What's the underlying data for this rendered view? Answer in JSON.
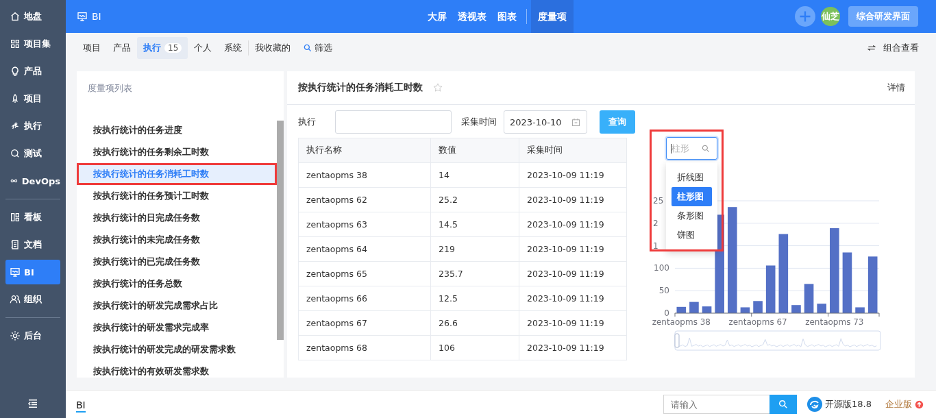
{
  "sidebar": {
    "groups": [
      [
        {
          "label": "地盘",
          "selected": false
        },
        {
          "label": "项目集",
          "selected": false
        },
        {
          "label": "产品",
          "selected": false
        },
        {
          "label": "项目",
          "selected": false
        },
        {
          "label": "执行",
          "selected": false
        },
        {
          "label": "测试",
          "selected": false
        },
        {
          "label": "DevOps",
          "selected": false
        }
      ],
      [
        {
          "label": "看板",
          "selected": false
        },
        {
          "label": "文档",
          "selected": false
        },
        {
          "label": "BI",
          "selected": true
        },
        {
          "label": "组织",
          "selected": false
        }
      ],
      [
        {
          "label": "后台",
          "selected": false
        }
      ]
    ]
  },
  "header": {
    "title": "BI",
    "nav": [
      {
        "label": "大屏",
        "selected": false
      },
      {
        "label": "透视表",
        "selected": false
      },
      {
        "label": "图表",
        "selected": false
      },
      {
        "label": "度量项",
        "selected": true
      }
    ],
    "avatar": "仙芝",
    "switch_button": "综合研发界面"
  },
  "subnav": {
    "tabs": [
      {
        "label": "项目",
        "selected": false
      },
      {
        "label": "产品",
        "selected": false
      },
      {
        "label": "执行",
        "count": "15",
        "selected": true
      },
      {
        "label": "个人",
        "selected": false
      },
      {
        "label": "系统",
        "selected": false
      },
      {
        "label": "我收藏的",
        "selected": false
      }
    ],
    "filter": "筛选",
    "combine": "组合查看"
  },
  "metric_list": {
    "title": "度量项列表",
    "items": [
      {
        "label": "按执行统计的任务进度",
        "selected": false,
        "highlighted": false
      },
      {
        "label": "按执行统计的任务剩余工时数",
        "selected": false,
        "highlighted": false
      },
      {
        "label": "按执行统计的任务消耗工时数",
        "selected": true,
        "highlighted": true
      },
      {
        "label": "按执行统计的任务预计工时数",
        "selected": false,
        "highlighted": false
      },
      {
        "label": "按执行统计的日完成任务数",
        "selected": false,
        "highlighted": false
      },
      {
        "label": "按执行统计的未完成任务数",
        "selected": false,
        "highlighted": false
      },
      {
        "label": "按执行统计的已完成任务数",
        "selected": false,
        "highlighted": false
      },
      {
        "label": "按执行统计的任务总数",
        "selected": false,
        "highlighted": false
      },
      {
        "label": "按执行统计的研发完成需求占比",
        "selected": false,
        "highlighted": false
      },
      {
        "label": "按执行统计的研发需求完成率",
        "selected": false,
        "highlighted": false
      },
      {
        "label": "按执行统计的研发完成的研发需求数",
        "selected": false,
        "highlighted": false
      },
      {
        "label": "按执行统计的有效研发需求数",
        "selected": false,
        "highlighted": false
      }
    ]
  },
  "detail": {
    "title": "按执行统计的任务消耗工时数",
    "details_link": "详情",
    "filters": {
      "execution_label": "执行",
      "time_label": "采集时间",
      "date": "2023-10-10",
      "query_button": "查询"
    },
    "table": {
      "columns": [
        "执行名称",
        "数值",
        "采集时间"
      ],
      "rows": [
        [
          "zentaopms 38",
          "14",
          "2023-10-09 11:19"
        ],
        [
          "zentaopms 62",
          "25.2",
          "2023-10-09 11:19"
        ],
        [
          "zentaopms 63",
          "14.5",
          "2023-10-09 11:19"
        ],
        [
          "zentaopms 64",
          "219",
          "2023-10-09 11:19"
        ],
        [
          "zentaopms 65",
          "235.7",
          "2023-10-09 11:19"
        ],
        [
          "zentaopms 66",
          "12.5",
          "2023-10-09 11:19"
        ],
        [
          "zentaopms 67",
          "26.6",
          "2023-10-09 11:19"
        ],
        [
          "zentaopms 68",
          "106",
          "2023-10-09 11:19"
        ]
      ]
    },
    "chart_type_picker": {
      "search_value": "柱形",
      "highlighted": true,
      "options": [
        {
          "label": "折线图",
          "selected": false
        },
        {
          "label": "柱形图",
          "selected": true
        },
        {
          "label": "条形图",
          "selected": false
        },
        {
          "label": "饼图",
          "selected": false
        }
      ]
    },
    "chart_data": {
      "type": "bar",
      "grid": true,
      "categories": [
        "zentaopms 38",
        null,
        null,
        null,
        null,
        null,
        "zentaopms 67",
        null,
        null,
        null,
        null,
        null,
        "zentaopms 73",
        null,
        null,
        null
      ],
      "series": [
        {
          "color": "#5470c6",
          "values": [
            14,
            25,
            15,
            219,
            236,
            13,
            27,
            106,
            176,
            18,
            65,
            21,
            189,
            135,
            13,
            126
          ]
        }
      ],
      "ylim": [
        0,
        250
      ],
      "yticks": [
        0,
        50,
        100
      ]
    },
    "covered_axis_labels": [
      "25",
      "2",
      "1"
    ]
  },
  "footer": {
    "tab": "BI",
    "search_placeholder": "请输入",
    "version": "开源版18.8",
    "enterprise": "企业版"
  }
}
